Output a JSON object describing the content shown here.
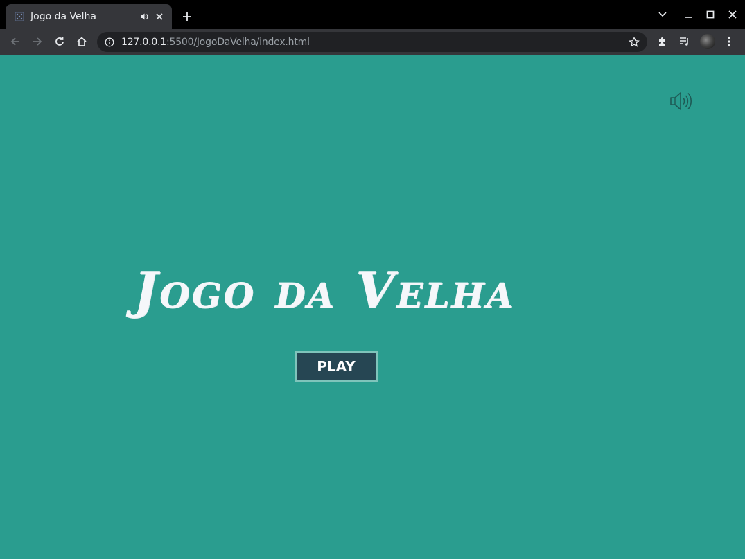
{
  "browser": {
    "tab": {
      "title": "Jogo da Velha",
      "favicon": "vscode-live-server-icon",
      "audio_icon": "speaker-playing-icon"
    },
    "address_bar": {
      "url_host": "127.0.0.1",
      "url_path": ":5500/JogoDaVelha/index.html"
    },
    "colors": {
      "frame": "#000000",
      "toolbar": "#35363a",
      "omnibox": "#202124"
    }
  },
  "page": {
    "title": "Jogo da Velha",
    "play_label": "PLAY",
    "sound_icon": "speaker-on-icon",
    "colors": {
      "background": "#2a9d8f",
      "title": "#f5f7fa",
      "button_bg": "#264653",
      "button_border": "#7fc4bb",
      "button_text": "#ffffff"
    }
  }
}
